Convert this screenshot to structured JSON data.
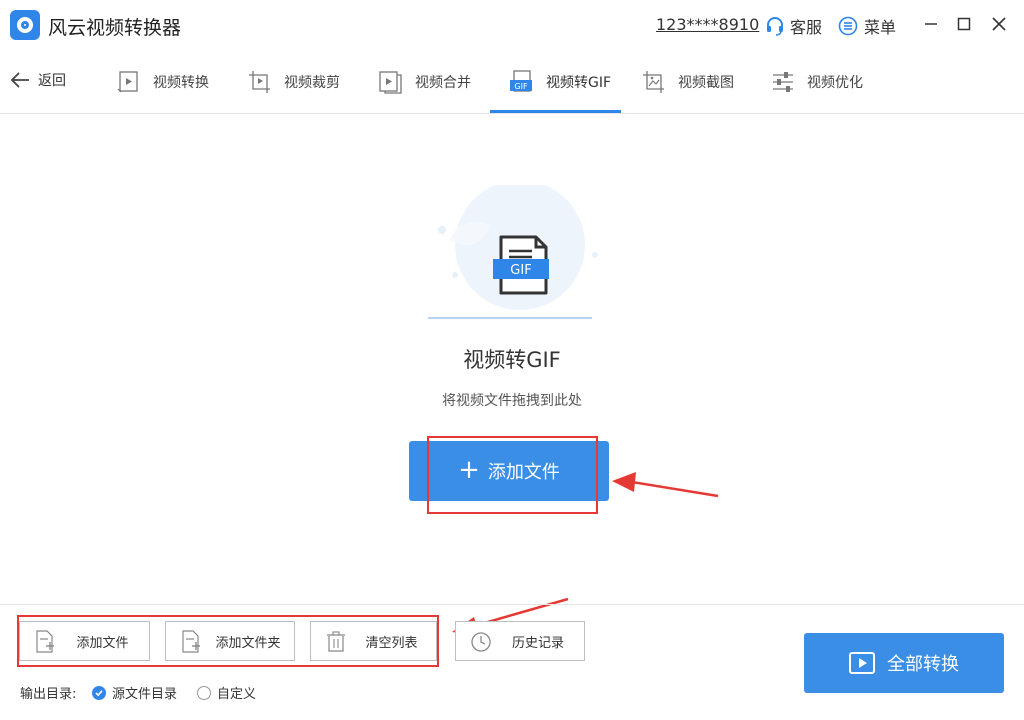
{
  "app": {
    "title": "风云视频转换器",
    "phone": "123****8910",
    "support_label": "客服",
    "menu_label": "菜单"
  },
  "nav": {
    "back_label": "返回",
    "tabs": [
      {
        "label": "视频转换",
        "icon": "video-convert-icon"
      },
      {
        "label": "视频裁剪",
        "icon": "video-crop-icon"
      },
      {
        "label": "视频合并",
        "icon": "video-merge-icon"
      },
      {
        "label": "视频转GIF",
        "icon": "video-to-gif-icon",
        "active": true
      },
      {
        "label": "视频截图",
        "icon": "screenshot-icon"
      },
      {
        "label": "视频优化",
        "icon": "optimize-icon"
      }
    ]
  },
  "main": {
    "illustration_badge": "GIF",
    "title": "视频转GIF",
    "subtitle": "将视频文件拖拽到此处",
    "add_button_label": "添加文件"
  },
  "bottom": {
    "buttons": [
      {
        "label": "添加文件",
        "icon": "add-file-icon"
      },
      {
        "label": "添加文件夹",
        "icon": "add-folder-icon"
      },
      {
        "label": "清空列表",
        "icon": "trash-icon"
      },
      {
        "label": "历史记录",
        "icon": "history-icon"
      }
    ],
    "output_label": "输出目录:",
    "output_options": [
      {
        "label": "源文件目录",
        "checked": true
      },
      {
        "label": "自定义",
        "checked": false
      }
    ],
    "convert_all_label": "全部转换"
  },
  "colors": {
    "accent": "#3a8ee6",
    "annotation": "#e53935"
  }
}
